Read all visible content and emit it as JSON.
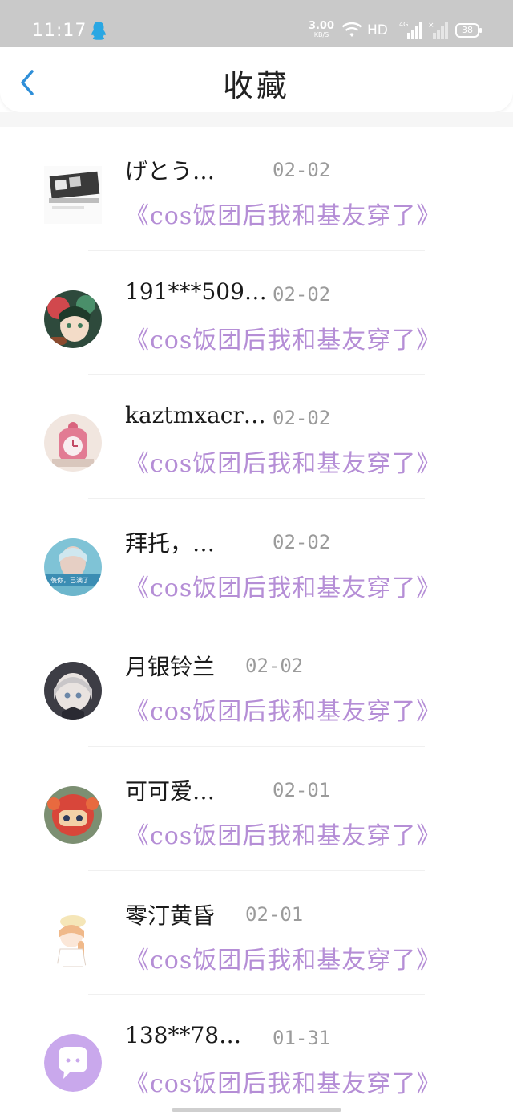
{
  "status_bar": {
    "time": "11:17",
    "speed_value": "3.00",
    "speed_unit": "KB/S",
    "network": "HD",
    "network_gen": "4G",
    "battery": "38"
  },
  "header": {
    "title": "收藏"
  },
  "colors": {
    "accent": "#2f8fd8",
    "title_purple": "#b58ed6",
    "date_gray": "#9b9b9b"
  },
  "favorites": [
    {
      "name": "げとう…",
      "date": "02-02",
      "title": "《cos饭团后我和基友穿了》",
      "avatar_icon": "photo-avatar"
    },
    {
      "name": "191***509…",
      "date": "02-02",
      "title": "《cos饭团后我和基友穿了》",
      "avatar_icon": "anime-avatar"
    },
    {
      "name": "kaztmxacr…",
      "date": "02-02",
      "title": "《cos饭团后我和基友穿了》",
      "avatar_icon": "clock-avatar"
    },
    {
      "name": "拜托，…",
      "date": "02-02",
      "title": "《cos饭团后我和基友穿了》",
      "avatar_icon": "photo-avatar",
      "avatar_caption": "羡你，已满了"
    },
    {
      "name": "月银铃兰",
      "date": "02-02",
      "title": "《cos饭团后我和基友穿了》",
      "avatar_icon": "anime-avatar"
    },
    {
      "name": "可可爱…",
      "date": "02-01",
      "title": "《cos饭团后我和基友穿了》",
      "avatar_icon": "robot-avatar"
    },
    {
      "name": "零汀黄昏",
      "date": "02-01",
      "title": "《cos饭团后我和基友穿了》",
      "avatar_icon": "anime-avatar"
    },
    {
      "name": "138**78…",
      "date": "01-31",
      "title": "《cos饭团后我和基友穿了》",
      "avatar_icon": "chat-bubble-avatar"
    }
  ]
}
